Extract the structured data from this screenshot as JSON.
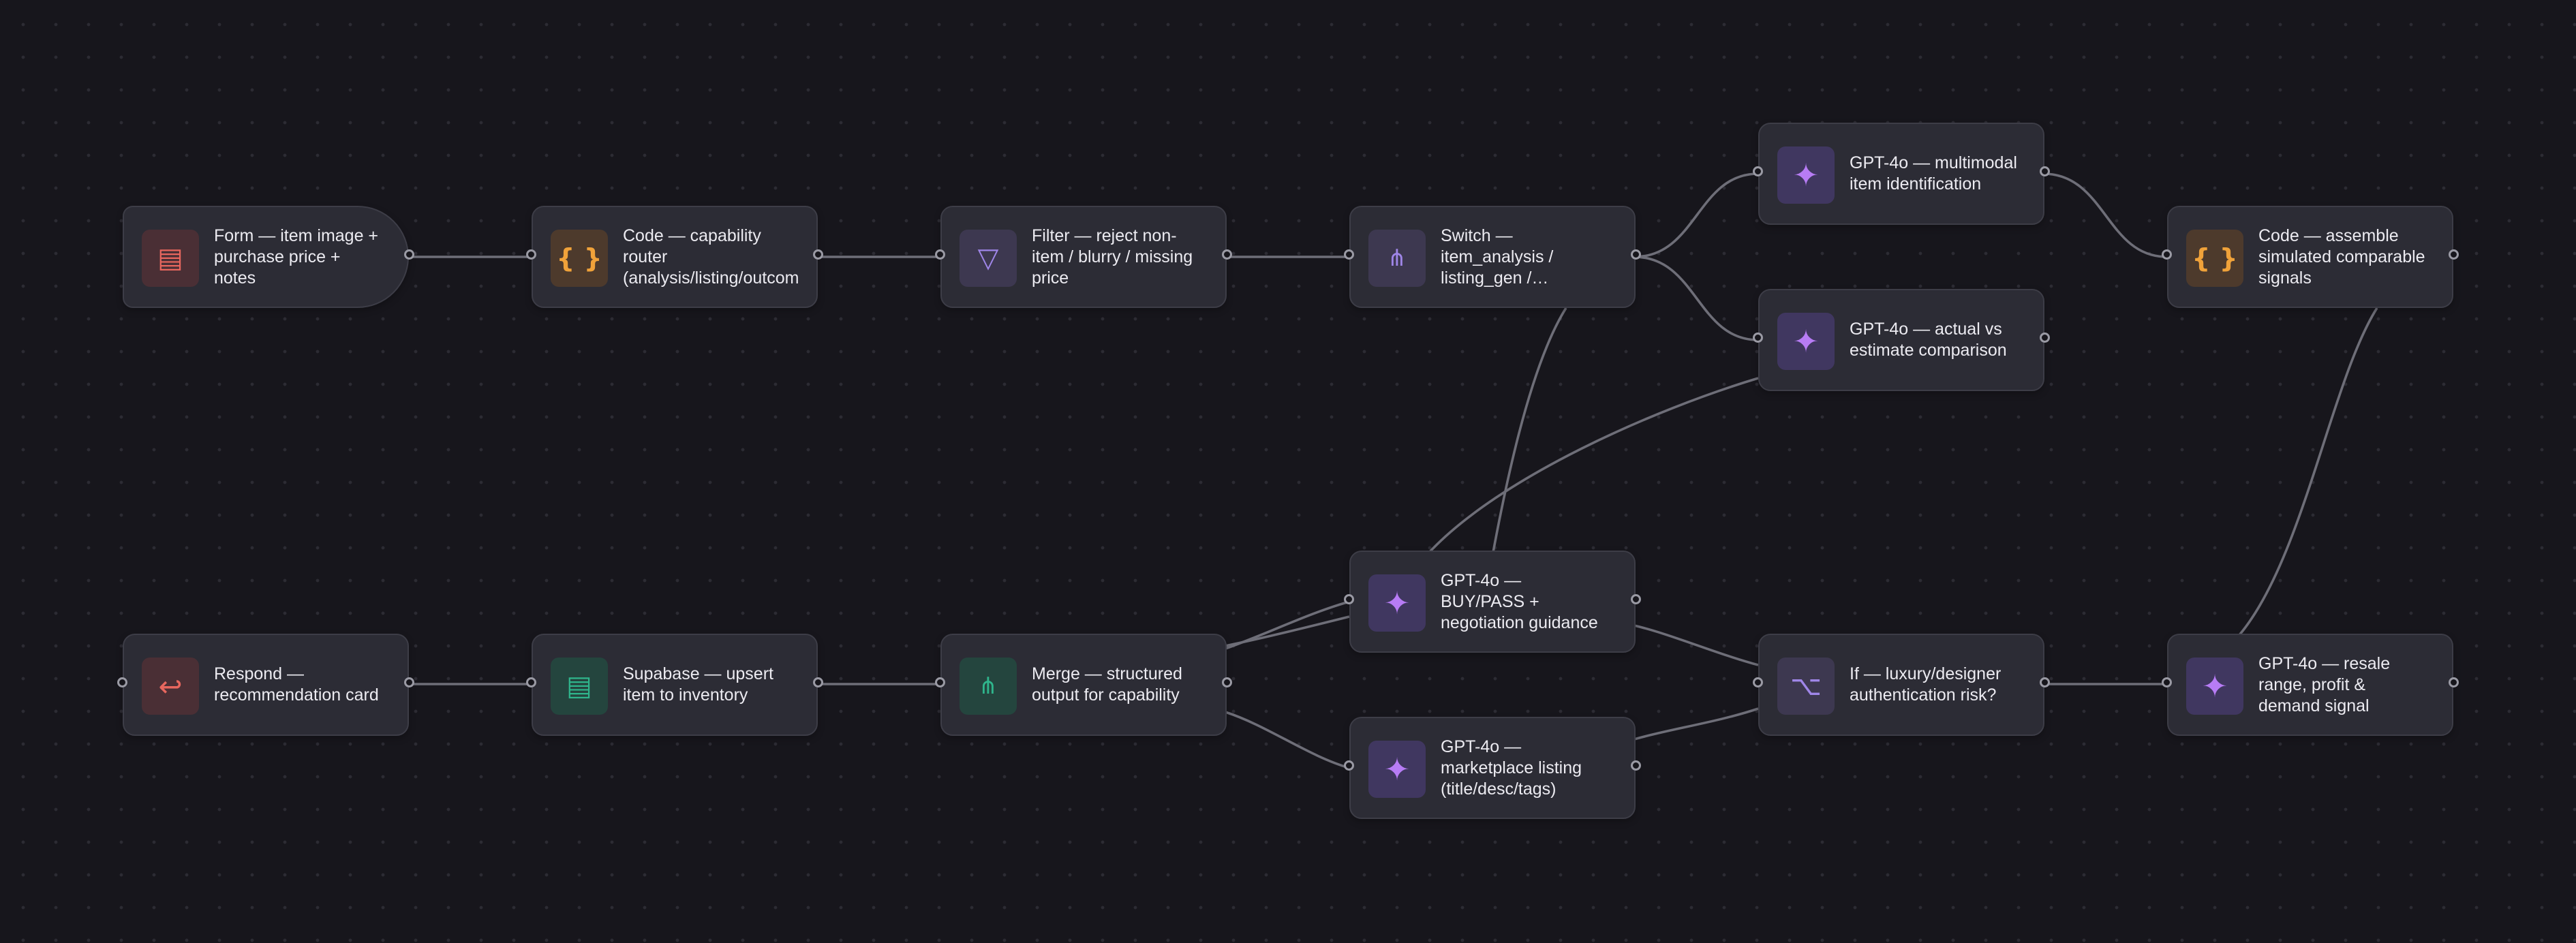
{
  "workflow": {
    "nodes": [
      {
        "id": "form",
        "label": "Form — item image +\npurchase price +\nnotes",
        "icon": "form-icon",
        "kind": "trigger"
      },
      {
        "id": "router",
        "label": "Code — capability\nrouter\n(analysis/listing/outcom",
        "icon": "braces-icon",
        "kind": "code"
      },
      {
        "id": "filter",
        "label": "Filter — reject non-\nitem / blurry / missing\nprice",
        "icon": "filter-icon",
        "kind": "filter"
      },
      {
        "id": "switch",
        "label": "Switch —\nitem_analysis /\nlisting_gen /…",
        "icon": "switch-icon",
        "kind": "switch"
      },
      {
        "id": "identify",
        "label": "GPT-4o — multimodal\nitem identification",
        "icon": "sparkle-icon",
        "kind": "ai"
      },
      {
        "id": "compare",
        "label": "GPT-4o — actual vs\nestimate comparison",
        "icon": "sparkle-icon",
        "kind": "ai"
      },
      {
        "id": "assemble",
        "label": "Code — assemble\nsimulated comparable\nsignals",
        "icon": "braces-icon",
        "kind": "code"
      },
      {
        "id": "buypass",
        "label": "GPT-4o —\nBUY/PASS +\nnegotiation guidance",
        "icon": "sparkle-icon",
        "kind": "ai"
      },
      {
        "id": "listing",
        "label": "GPT-4o —\nmarketplace listing\n(title/desc/tags)",
        "icon": "sparkle-icon",
        "kind": "ai"
      },
      {
        "id": "ifauth",
        "label": "If — luxury/designer\nauthentication risk?",
        "icon": "if-branch-icon",
        "kind": "if"
      },
      {
        "id": "resale",
        "label": "GPT-4o — resale\nrange, profit &\ndemand signal",
        "icon": "sparkle-icon",
        "kind": "ai"
      },
      {
        "id": "merge",
        "label": "Merge — structured\noutput for capability",
        "icon": "merge-icon",
        "kind": "merge"
      },
      {
        "id": "supabase",
        "label": "Supabase — upsert\nitem to inventory",
        "icon": "database-icon",
        "kind": "db"
      },
      {
        "id": "respond",
        "label": "Respond —\nrecommendation card",
        "icon": "return-icon",
        "kind": "respond"
      }
    ],
    "connections": [
      [
        "form",
        "router"
      ],
      [
        "router",
        "filter"
      ],
      [
        "filter",
        "switch"
      ],
      [
        "switch",
        "identify"
      ],
      [
        "switch",
        "compare"
      ],
      [
        "switch",
        "listing"
      ],
      [
        "identify",
        "assemble"
      ],
      [
        "assemble",
        "resale"
      ],
      [
        "compare",
        "merge"
      ],
      [
        "resale",
        "ifauth"
      ],
      [
        "ifauth",
        "buypass"
      ],
      [
        "ifauth",
        "listing"
      ],
      [
        "buypass",
        "merge"
      ],
      [
        "listing",
        "merge"
      ],
      [
        "merge",
        "supabase"
      ],
      [
        "supabase",
        "respond"
      ]
    ]
  },
  "colors": {
    "background": "#17161c",
    "node_fill": "#2c2c35",
    "edge": "#6e6e78",
    "ai_accent": "#b77cf5",
    "code_accent": "#f0a23a",
    "form_accent": "#e8675e",
    "data_accent": "#2fb58c"
  }
}
